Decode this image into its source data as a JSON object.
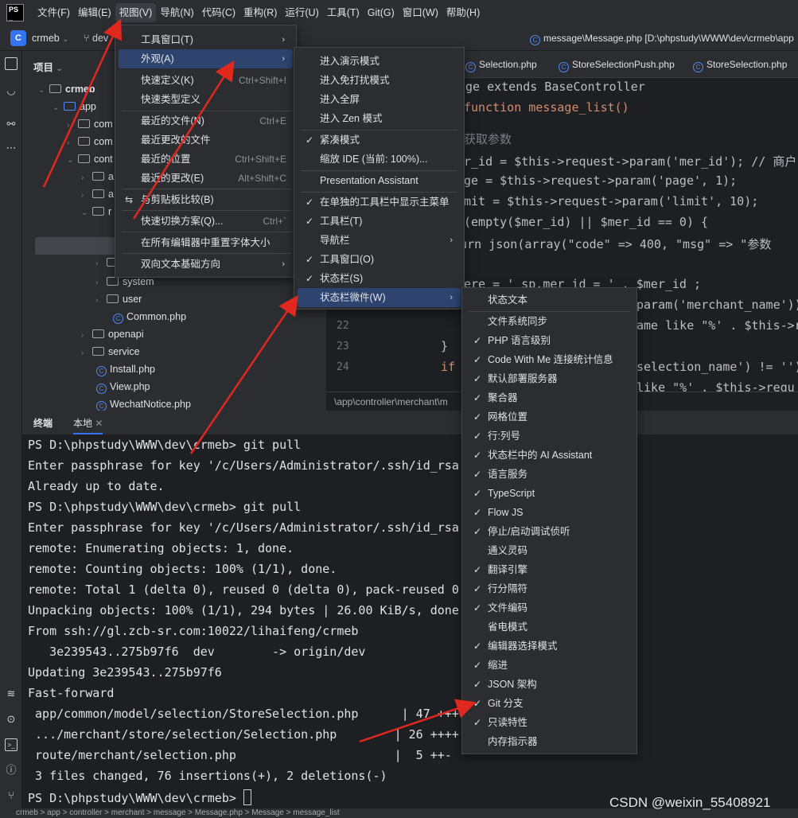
{
  "menubar": {
    "items": [
      "文件(F)",
      "编辑(E)",
      "视图(V)",
      "导航(N)",
      "代码(C)",
      "重构(R)",
      "运行(U)",
      "工具(T)",
      "Git(G)",
      "窗口(W)",
      "帮助(H)"
    ],
    "active": "视图(V)"
  },
  "toolbar": {
    "project_letter": "C",
    "project_name": "crmeb",
    "branch": "dev",
    "file_path": "message\\Message.php [D:\\phpstudy\\WWW\\dev\\crmeb\\app"
  },
  "project_panel": {
    "title": "项目",
    "tree": [
      "crmeb",
      "app",
      "com",
      "com",
      "cont",
      "a",
      "a",
      "r",
      "r",
      "system",
      "user",
      "Common.php",
      "openapi",
      "service",
      "Install.php",
      "View.php",
      "WechatNotice.php"
    ]
  },
  "editor": {
    "tabs": [
      "Selection.php",
      "StoreSelectionPush.php",
      "StoreSelection.php"
    ],
    "code_lines": [
      {
        "text": "ge extends BaseController"
      },
      {
        "text": "function message_list()"
      },
      {
        "text": "获取参数"
      },
      {
        "text": "r_id = $this->request->param('mer_id'); // 商户"
      },
      {
        "text": "ge = $this->request->param('page', 1);"
      },
      {
        "text": "mit = $this->request->param('limit', 10);"
      },
      {
        "text": "(empty($mer_id) || $mer_id == 0) {"
      },
      {
        "text": "    return json(array(\"code\" => 400, \"msg\" => \"参数"
      },
      {
        "text": "ere = ' sp.mer_id = ' . $mer_id ;"
      },
      {
        "text": "param('merchant_name'))"
      },
      {
        "text": "ame like \"%' . $this->r"
      },
      {
        "text": "}"
      },
      {
        "text": "if"
      },
      {
        "text": "selection_name') != '')"
      },
      {
        "text": " like \"%' . $this->requ"
      }
    ],
    "line_numbers": [
      "22",
      "23",
      "24"
    ],
    "breadcrumb": "\\app\\controller\\merchant\\m"
  },
  "terminal": {
    "tabs": [
      "终端",
      "本地"
    ],
    "lines": [
      "PS D:\\phpstudy\\WWW\\dev\\crmeb> git pull",
      "Enter passphrase for key '/c/Users/Administrator/.ssh/id_rsa':",
      "Already up to date.",
      "PS D:\\phpstudy\\WWW\\dev\\crmeb> git pull",
      "Enter passphrase for key '/c/Users/Administrator/.ssh/id_rsa':",
      "remote: Enumerating objects: 1, done.",
      "remote: Counting objects: 100% (1/1), done.",
      "remote: Total 1 (delta 0), reused 0 (delta 0), pack-reused 0",
      "Unpacking objects: 100% (1/1), 294 bytes | 26.00 KiB/s, done.",
      "From ssh://gl.zcb-sr.com:10022/lihaifeng/crmeb",
      "   3e239543..275b97f6  dev        -> origin/dev",
      "Updating 3e239543..275b97f6",
      "Fast-forward",
      " app/common/model/selection/StoreSelection.php      | 47 ++++",
      " .../merchant/store/selection/Selection.php        | 26 ++++",
      " route/merchant/selection.php                      |  5 ++-",
      " 3 files changed, 76 insertions(+), 2 deletions(-)",
      "PS D:\\phpstudy\\WWW\\dev\\crmeb> "
    ]
  },
  "menu1": [
    {
      "label": "工具窗口(T)",
      "submenu": true
    },
    {
      "label": "外观(A)",
      "submenu": true,
      "selected": true
    },
    {
      "label": "快速定义(K)",
      "shortcut": "Ctrl+Shift+I"
    },
    {
      "label": "快速类型定义"
    },
    {
      "label": "最近的文件(N)",
      "shortcut": "Ctrl+E"
    },
    {
      "label": "最近更改的文件"
    },
    {
      "label": "最近的位置",
      "shortcut": "Ctrl+Shift+E"
    },
    {
      "label": "最近的更改(E)",
      "shortcut": "Alt+Shift+C"
    },
    {
      "label": "与剪贴板比较(B)"
    },
    {
      "label": "快速切换方案(Q)...",
      "shortcut": "Ctrl+`"
    },
    {
      "label": "在所有编辑器中重置字体大小"
    },
    {
      "label": "双向文本基础方向",
      "submenu": true
    }
  ],
  "menu2": [
    {
      "label": "进入演示模式"
    },
    {
      "label": "进入免打扰模式"
    },
    {
      "label": "进入全屏"
    },
    {
      "label": "进入 Zen 模式"
    },
    {
      "label": "紧凑模式",
      "checked": true
    },
    {
      "label": "缩放 IDE (当前: 100%)..."
    },
    {
      "label": "Presentation Assistant"
    },
    {
      "label": "在单独的工具栏中显示主菜单",
      "checked": true
    },
    {
      "label": "工具栏(T)",
      "checked": true
    },
    {
      "label": "导航栏",
      "submenu": true
    },
    {
      "label": "工具窗口(O)",
      "checked": true
    },
    {
      "label": "状态栏(S)",
      "checked": true
    },
    {
      "label": "状态栏微件(W)",
      "submenu": true,
      "selected": true
    }
  ],
  "menu3": [
    {
      "label": "状态文本"
    },
    {
      "label": "文件系统同步"
    },
    {
      "label": "PHP 语言级别",
      "checked": true
    },
    {
      "label": "Code With Me 连接统计信息",
      "checked": true
    },
    {
      "label": "默认部署服务器",
      "checked": true
    },
    {
      "label": "聚合器",
      "checked": true
    },
    {
      "label": "网格位置",
      "checked": true
    },
    {
      "label": "行:列号",
      "checked": true
    },
    {
      "label": "状态栏中的 AI Assistant",
      "checked": true
    },
    {
      "label": "语言服务",
      "checked": true
    },
    {
      "label": "TypeScript",
      "checked": true
    },
    {
      "label": "Flow JS",
      "checked": true
    },
    {
      "label": "停止/启动调试侦听",
      "checked": true
    },
    {
      "label": "通义灵码"
    },
    {
      "label": "翻译引擎",
      "checked": true
    },
    {
      "label": "行分隔符",
      "checked": true
    },
    {
      "label": "文件编码",
      "checked": true
    },
    {
      "label": "省电模式"
    },
    {
      "label": "编辑器选择模式",
      "checked": true
    },
    {
      "label": "缩进",
      "checked": true
    },
    {
      "label": "JSON 架构",
      "checked": true
    },
    {
      "label": "Git 分支",
      "checked": true
    },
    {
      "label": "只读特性",
      "checked": true
    },
    {
      "label": "内存指示器"
    }
  ],
  "statusbar": "crmeb > app > controller > merchant > message > Message.php > Message > message_list",
  "watermark": "CSDN @weixin_55408921",
  "colors": {
    "accent": "#2e436e",
    "annotation": "#e0281f",
    "keyword": "#cf8e6d",
    "variable": "#c77dbb",
    "string": "#6aab73",
    "number": "#2aacb8"
  }
}
